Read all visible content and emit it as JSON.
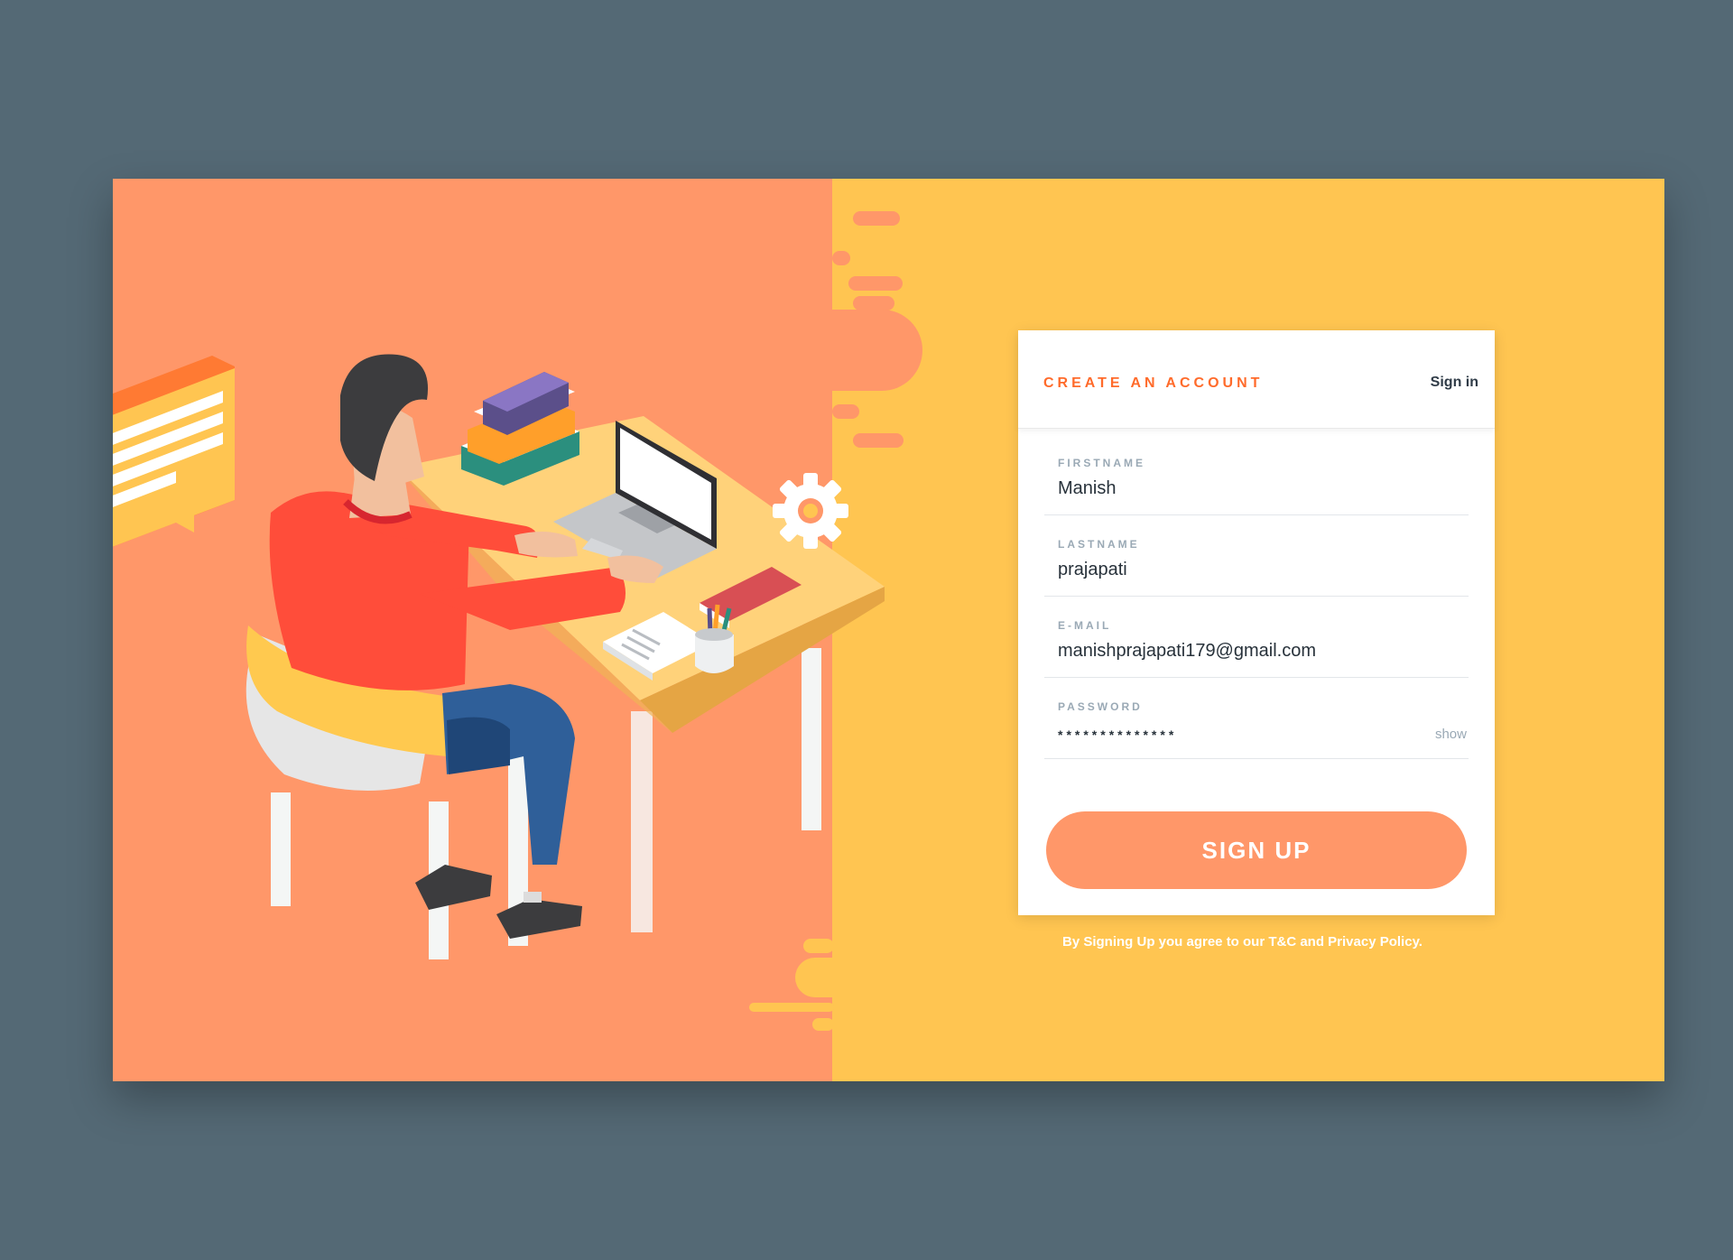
{
  "form": {
    "title": "CREATE AN ACCOUNT",
    "sign_in_label": "Sign in",
    "fields": [
      {
        "label": "FIRSTNAME",
        "value": "Manish"
      },
      {
        "label": "LASTNAME",
        "value": "prajapati"
      },
      {
        "label": "E-MAIL",
        "value": "manishprajapati179@gmail.com"
      },
      {
        "label": "PASSWORD",
        "value": "**************"
      }
    ],
    "show_label": "show",
    "signup_label": "SIGN UP",
    "agreement": "By Signing Up you agree to our T&C and Privacy Policy."
  },
  "colors": {
    "background": "#546975",
    "left_panel": "#ff9769",
    "right_panel": "#ffc551",
    "accent": "#ff6b2b",
    "button": "#ff9769"
  },
  "icons": [
    "chat-bubble-icon",
    "gear-icon"
  ]
}
